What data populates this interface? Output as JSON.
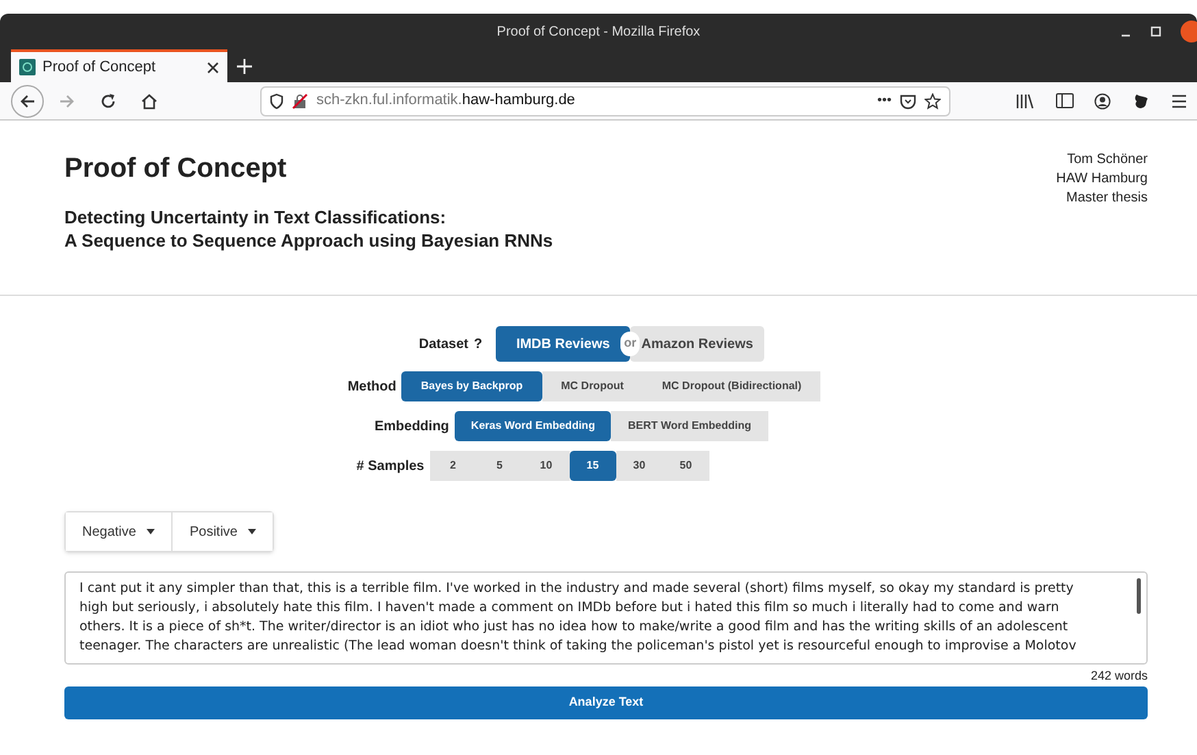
{
  "window": {
    "title": "Proof of Concept - Mozilla Firefox"
  },
  "tabs": [
    {
      "label": "Proof of Concept",
      "selected": true
    }
  ],
  "address_bar": {
    "url_prefix": "sch-zkn.ful.informatik.",
    "url_domain": "haw-hamburg.de",
    "more": "•••"
  },
  "header": {
    "title": "Proof of Concept",
    "subtitle_lines": [
      "Detecting Uncertainty in Text Classifications:",
      "A Sequence to Sequence Approach using Bayesian RNNs"
    ],
    "author_lines": [
      "Tom Schöner",
      "HAW Hamburg",
      "Master thesis"
    ]
  },
  "dataset": {
    "label": "Dataset",
    "help": "?",
    "separator": "or",
    "options": [
      {
        "label": "IMDB Reviews",
        "selected": true
      },
      {
        "label": "Amazon Reviews",
        "selected": false
      }
    ]
  },
  "method": {
    "label": "Method",
    "options": [
      {
        "label": "Bayes by Backprop",
        "selected": true
      },
      {
        "label": "MC Dropout",
        "selected": false
      },
      {
        "label": "MC Dropout (Bidirectional)",
        "selected": false
      }
    ]
  },
  "embedding": {
    "label": "Embedding",
    "options": [
      {
        "label": "Keras Word Embedding",
        "selected": true
      },
      {
        "label": "BERT Word Embedding",
        "selected": false
      }
    ]
  },
  "samples": {
    "label": "# Samples",
    "options": [
      {
        "label": "2",
        "selected": false
      },
      {
        "label": "5",
        "selected": false
      },
      {
        "label": "10",
        "selected": false
      },
      {
        "label": "15",
        "selected": true
      },
      {
        "label": "30",
        "selected": false
      },
      {
        "label": "50",
        "selected": false
      }
    ]
  },
  "filters": [
    {
      "label": "Negative"
    },
    {
      "label": "Positive"
    }
  ],
  "review_text_lines": [
    "I cant put it any simpler than that, this is a terrible film. I've worked in the industry and made several (short) films myself, so okay my standard is pretty",
    "high but seriously, i absolutely hate this film. I haven't made a comment on IMDb before but i hated this film so much i literally had to come and warn",
    "others. It is a piece of sh*t. The writer/director is an idiot who just has no idea how to make/write a good film and has the writing skills of an adolescent",
    "teenager. The characters are unrealistic (The lead woman doesn't think of taking the policeman's pistol yet is resourceful enough to improvise a Molotov"
  ],
  "word_count": "242 words",
  "analyze_button": "Analyze Text"
}
